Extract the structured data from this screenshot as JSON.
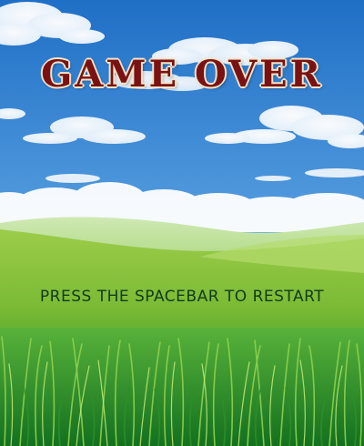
{
  "game_over": {
    "title": "GAME OVER",
    "prompt": "PRESS THE SPACEBAR TO RESTART"
  },
  "colors": {
    "title_fill": "#7a1212",
    "title_outline": "#f3e3c8",
    "prompt_text": "#123a1c",
    "sky_top": "#1e6fc6",
    "sky_bottom": "#8ec3ee",
    "grass_light": "#8cc63f",
    "grass_dark": "#1f8a2b"
  },
  "icons": {
    "background": "meadow-sky-background"
  }
}
